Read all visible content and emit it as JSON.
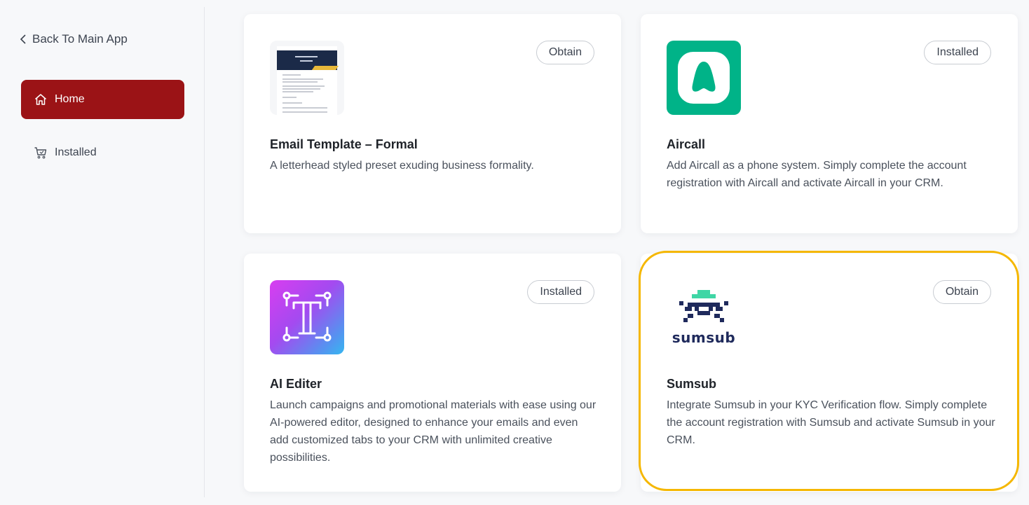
{
  "sidebar": {
    "back_label": "Back To Main App",
    "items": [
      {
        "label": "Home",
        "icon": "home-icon",
        "active": true
      },
      {
        "label": "Installed",
        "icon": "cart-icon",
        "active": false
      }
    ]
  },
  "cards": [
    {
      "title": "Email Template – Formal",
      "description": "A letterhead styled preset exuding business formality.",
      "action": "Obtain",
      "icon": "email-template-preview"
    },
    {
      "title": "Aircall",
      "description": "Add Aircall as a phone system. Simply complete the account registration with Aircall and activate Aircall in your CRM.",
      "action": "Installed",
      "icon": "aircall-logo"
    },
    {
      "title": "AI Editer",
      "description": "Launch campaigns and promotional materials with ease using our AI-powered editor, designed to enhance your emails and even add customized tabs to your CRM with unlimited creative possibilities.",
      "action": "Installed",
      "icon": "ai-editer-logo"
    },
    {
      "title": "Sumsub",
      "description": "Integrate Sumsub in your KYC Verification flow. Simply complete the account registration with Sumsub and activate Sumsub in your CRM.",
      "action": "Obtain",
      "icon": "sumsub-logo",
      "logo_text": "sumsub",
      "highlighted": true
    }
  ],
  "colors": {
    "active_nav": "#9b1316",
    "highlight": "#f5b700",
    "aircall_green": "#00b388",
    "sumsub_navy": "#1f2a5c",
    "sumsub_teal": "#3fd6a5"
  }
}
